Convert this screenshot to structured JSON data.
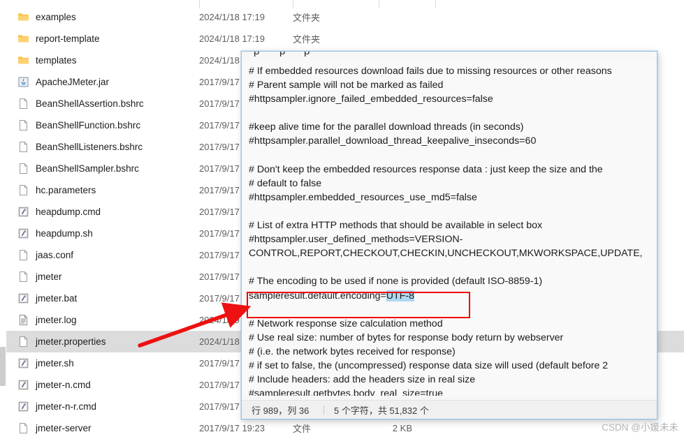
{
  "explorer": {
    "column_divider_x": [
      285,
      419,
      542,
      623
    ],
    "rows": [
      {
        "name": "examples",
        "icon": "folder-icon",
        "date": "2024/1/18 17:19",
        "type": "文件夹",
        "size": "",
        "selected": false
      },
      {
        "name": "report-template",
        "icon": "folder-icon",
        "date": "2024/1/18 17:19",
        "type": "文件夹",
        "size": "",
        "selected": false
      },
      {
        "name": "templates",
        "icon": "folder-icon",
        "date": "2024/1/18",
        "type": "",
        "size": "",
        "selected": false
      },
      {
        "name": "ApacheJMeter.jar",
        "icon": "java-jar-icon",
        "date": "2017/9/17",
        "type": "",
        "size": "",
        "selected": false
      },
      {
        "name": "BeanShellAssertion.bshrc",
        "icon": "generic-file-icon",
        "date": "2017/9/17",
        "type": "",
        "size": "",
        "selected": false
      },
      {
        "name": "BeanShellFunction.bshrc",
        "icon": "generic-file-icon",
        "date": "2017/9/17",
        "type": "",
        "size": "",
        "selected": false
      },
      {
        "name": "BeanShellListeners.bshrc",
        "icon": "generic-file-icon",
        "date": "2017/9/17",
        "type": "",
        "size": "",
        "selected": false
      },
      {
        "name": "BeanShellSampler.bshrc",
        "icon": "generic-file-icon",
        "date": "2017/9/17",
        "type": "",
        "size": "",
        "selected": false
      },
      {
        "name": "hc.parameters",
        "icon": "generic-file-icon",
        "date": "2017/9/17",
        "type": "",
        "size": "",
        "selected": false
      },
      {
        "name": "heapdump.cmd",
        "icon": "script-cmd-icon",
        "date": "2017/9/17",
        "type": "",
        "size": "",
        "selected": false
      },
      {
        "name": "heapdump.sh",
        "icon": "script-cmd-icon",
        "date": "2017/9/17",
        "type": "",
        "size": "",
        "selected": false
      },
      {
        "name": "jaas.conf",
        "icon": "generic-file-icon",
        "date": "2017/9/17",
        "type": "",
        "size": "",
        "selected": false
      },
      {
        "name": "jmeter",
        "icon": "generic-file-icon",
        "date": "2017/9/17",
        "type": "",
        "size": "",
        "selected": false
      },
      {
        "name": "jmeter.bat",
        "icon": "script-cmd-icon",
        "date": "2017/9/17",
        "type": "",
        "size": "",
        "selected": false
      },
      {
        "name": "jmeter.log",
        "icon": "log-file-icon",
        "date": "2024/1/19",
        "type": "",
        "size": "",
        "selected": false
      },
      {
        "name": "jmeter.properties",
        "icon": "generic-file-icon",
        "date": "2024/1/18",
        "type": "",
        "size": "",
        "selected": true
      },
      {
        "name": "jmeter.sh",
        "icon": "script-cmd-icon",
        "date": "2017/9/17",
        "type": "",
        "size": "",
        "selected": false
      },
      {
        "name": "jmeter-n.cmd",
        "icon": "script-cmd-icon",
        "date": "2017/9/17",
        "type": "",
        "size": "",
        "selected": false
      },
      {
        "name": "jmeter-n-r.cmd",
        "icon": "script-cmd-icon",
        "date": "2017/9/17",
        "type": "",
        "size": "",
        "selected": false
      },
      {
        "name": "jmeter-server",
        "icon": "generic-file-icon",
        "date": "2017/9/17 19:23",
        "type": "文件",
        "size": "2 KB",
        "selected": false
      }
    ]
  },
  "notepad": {
    "clipped_top_glyphs": "p  p  p",
    "lines": [
      {
        "text": "# If embedded resources download fails due to missing resources or other reasons"
      },
      {
        "text": "# Parent sample will not be marked as failed"
      },
      {
        "text": "#httpsampler.ignore_failed_embedded_resources=false"
      },
      {
        "text": ""
      },
      {
        "text": "#keep alive time for the parallel download threads (in seconds)"
      },
      {
        "text": "#httpsampler.parallel_download_thread_keepalive_inseconds=60"
      },
      {
        "text": ""
      },
      {
        "text": "# Don't keep the embedded resources response data : just keep the size and the"
      },
      {
        "text": "# default to false"
      },
      {
        "text": "#httpsampler.embedded_resources_use_md5=false"
      },
      {
        "text": ""
      },
      {
        "text": "# List of extra HTTP methods that should be available in select box"
      },
      {
        "text": "#httpsampler.user_defined_methods=VERSION-"
      },
      {
        "text": "CONTROL,REPORT,CHECKOUT,CHECKIN,UNCHECKOUT,MKWORKSPACE,UPDATE,"
      },
      {
        "text": ""
      },
      {
        "text": "# The encoding to be used if none is provided (default ISO-8859-1)"
      },
      {
        "text": "sampleresult.default.encoding=",
        "highlight": "UTF-8"
      },
      {
        "text": ""
      },
      {
        "text": "# Network response size calculation method"
      },
      {
        "text": "# Use real size: number of bytes for response body return by webserver"
      },
      {
        "text": "# (i.e. the network bytes received for response)"
      },
      {
        "text": "# if set to false, the (uncompressed) response data size will used (default before 2"
      },
      {
        "text": "# Include headers: add the headers size in real size"
      },
      {
        "text": "#sampleresult.getbytes.body_real_size=true"
      }
    ],
    "status": {
      "position": "行 989，列 36",
      "characters": "5 个字符，共 51,832 个"
    }
  },
  "annotations": {
    "red_box_target": "sampleresult.default.encoding=UTF-8",
    "arrow_color": "#ee1111",
    "box_color": "#f10000"
  },
  "watermark": {
    "text": "CSDN @小媛未未"
  }
}
